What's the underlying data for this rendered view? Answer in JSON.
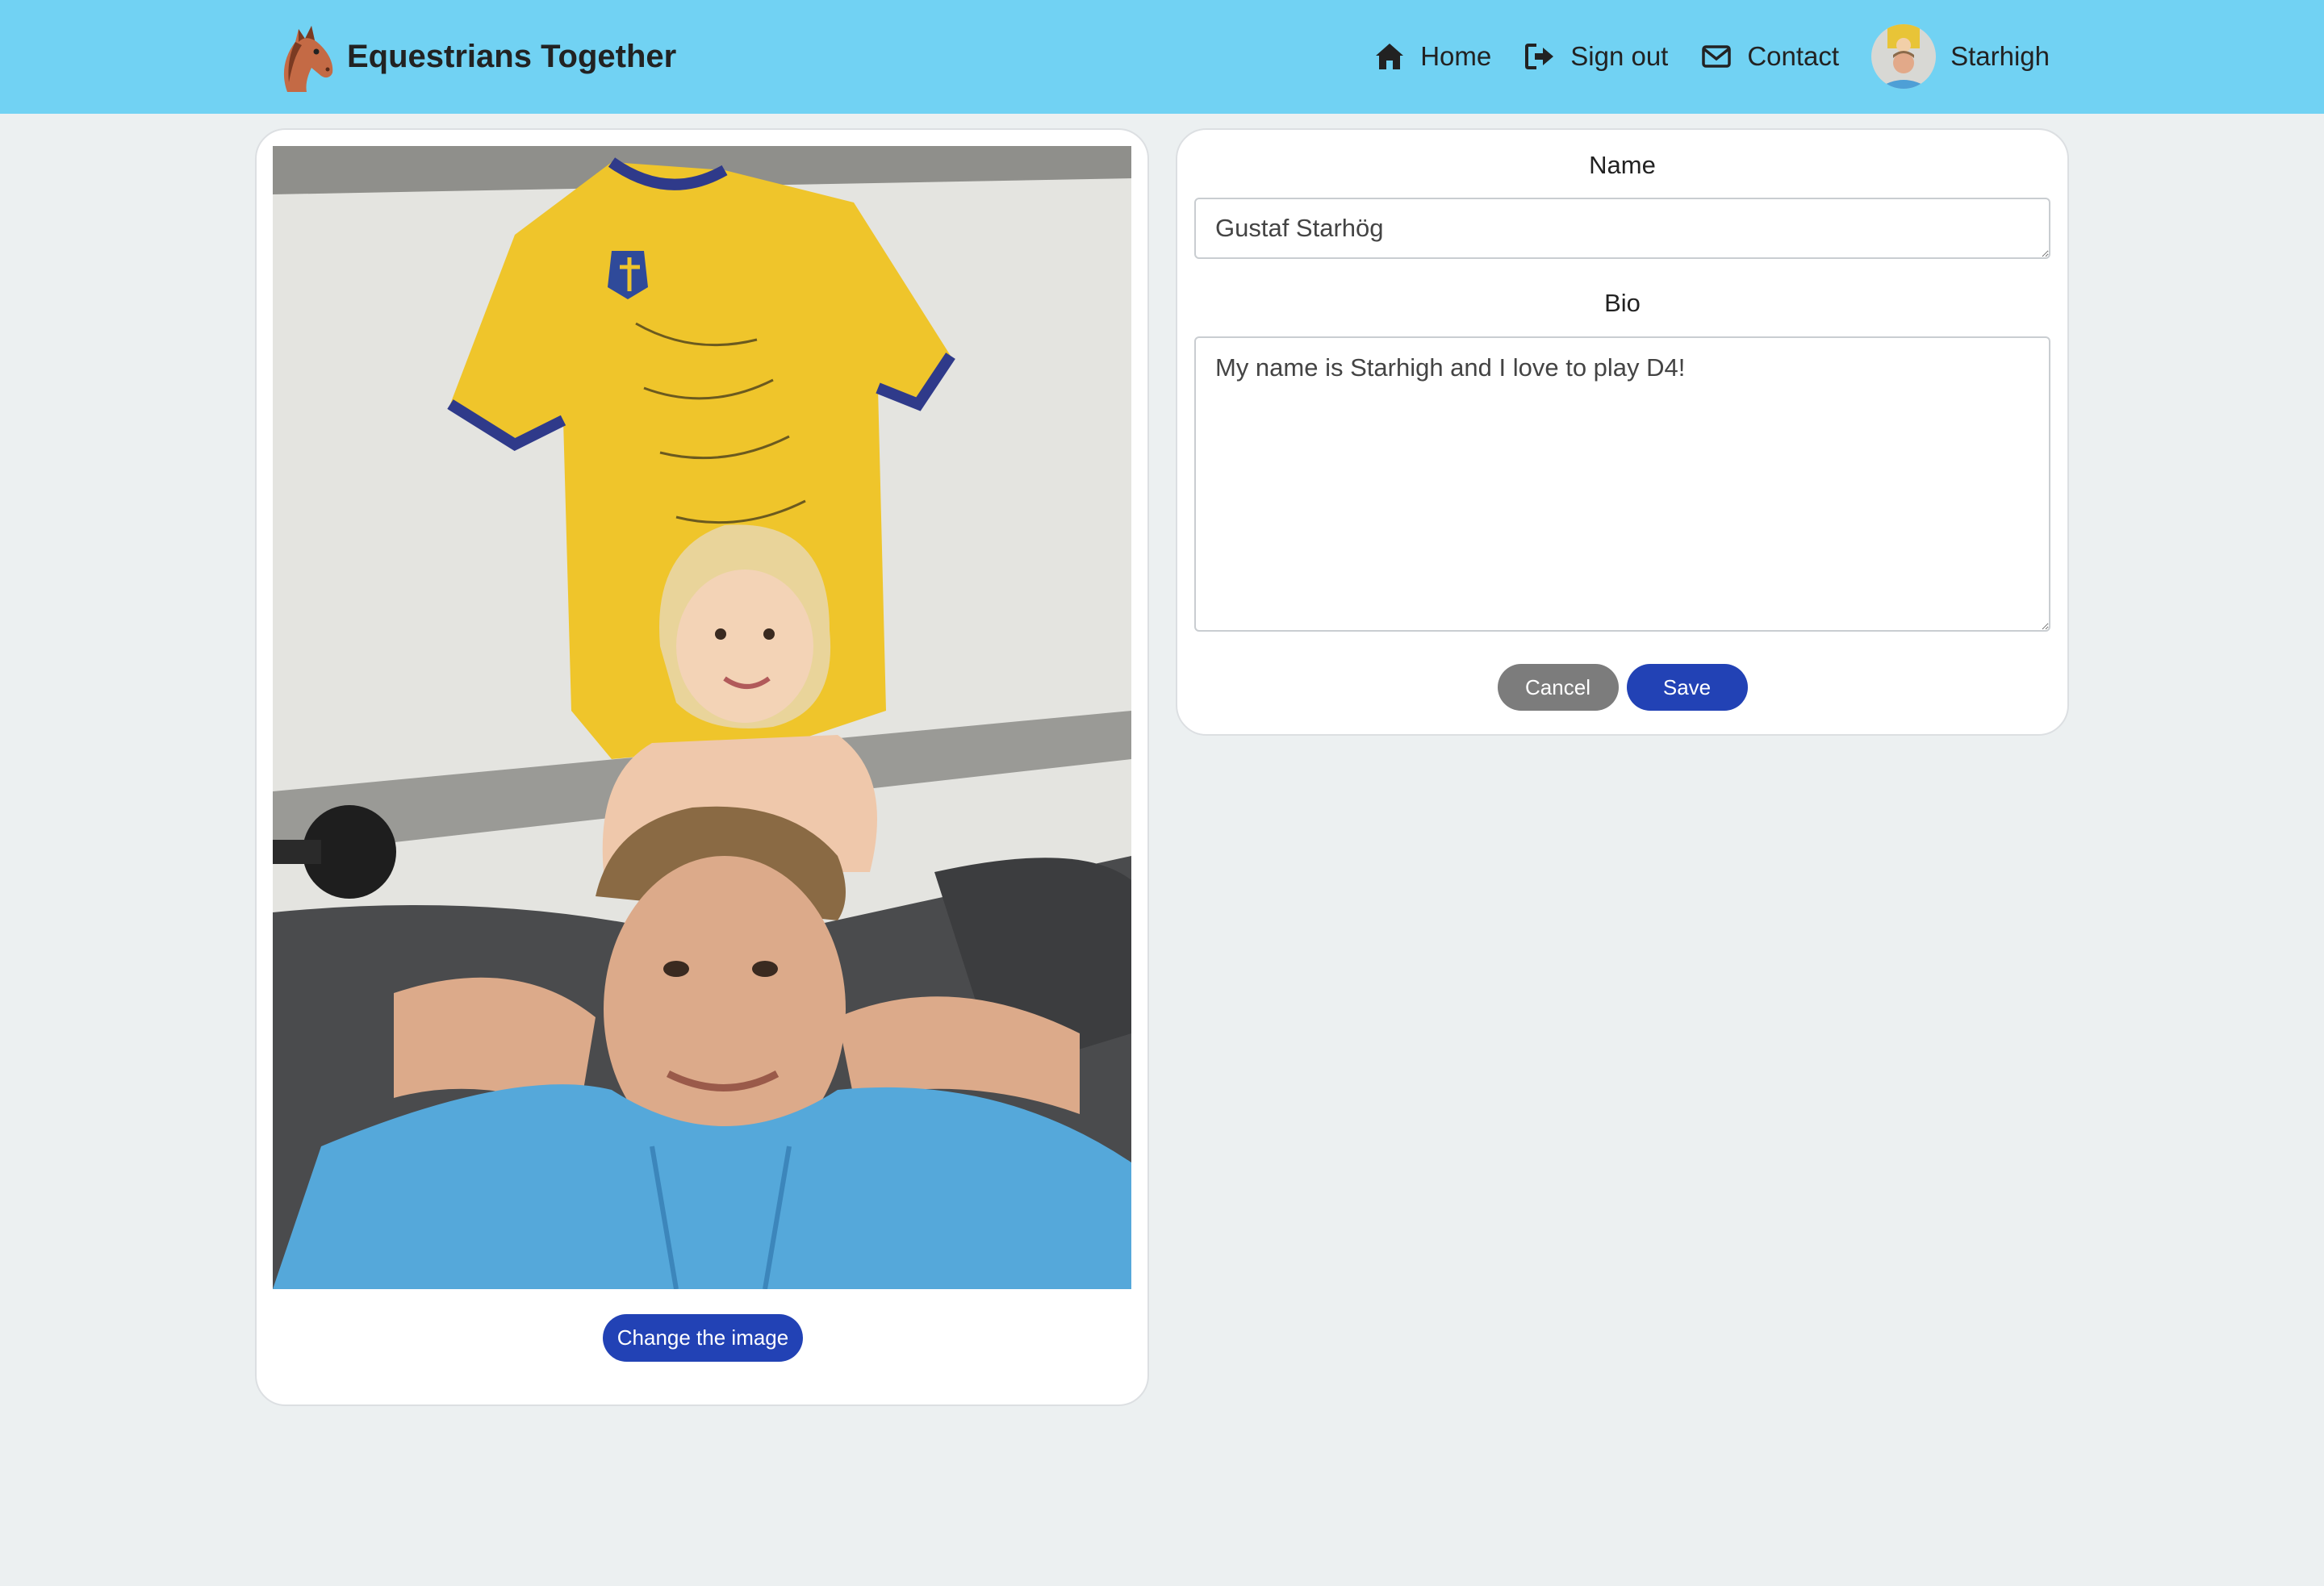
{
  "navbar": {
    "brand": "Equestrians Together",
    "links": [
      {
        "label": "Home",
        "icon": "home-icon"
      },
      {
        "label": "Sign out",
        "icon": "sign-out-icon"
      },
      {
        "label": "Contact",
        "icon": "envelope-icon"
      }
    ],
    "user": {
      "name": "Starhigh"
    },
    "background_color": "#71d2f3"
  },
  "image_card": {
    "change_button_label": "Change the image"
  },
  "form": {
    "name_label": "Name",
    "name_value": "Gustaf Starhög",
    "bio_label": "Bio",
    "bio_value": "My name is Starhigh and I love to play D4!",
    "cancel_label": "Cancel",
    "save_label": "Save"
  },
  "colors": {
    "primary": "#2242b5",
    "secondary": "#7c7c7c",
    "page_background": "#ecf0f1"
  }
}
